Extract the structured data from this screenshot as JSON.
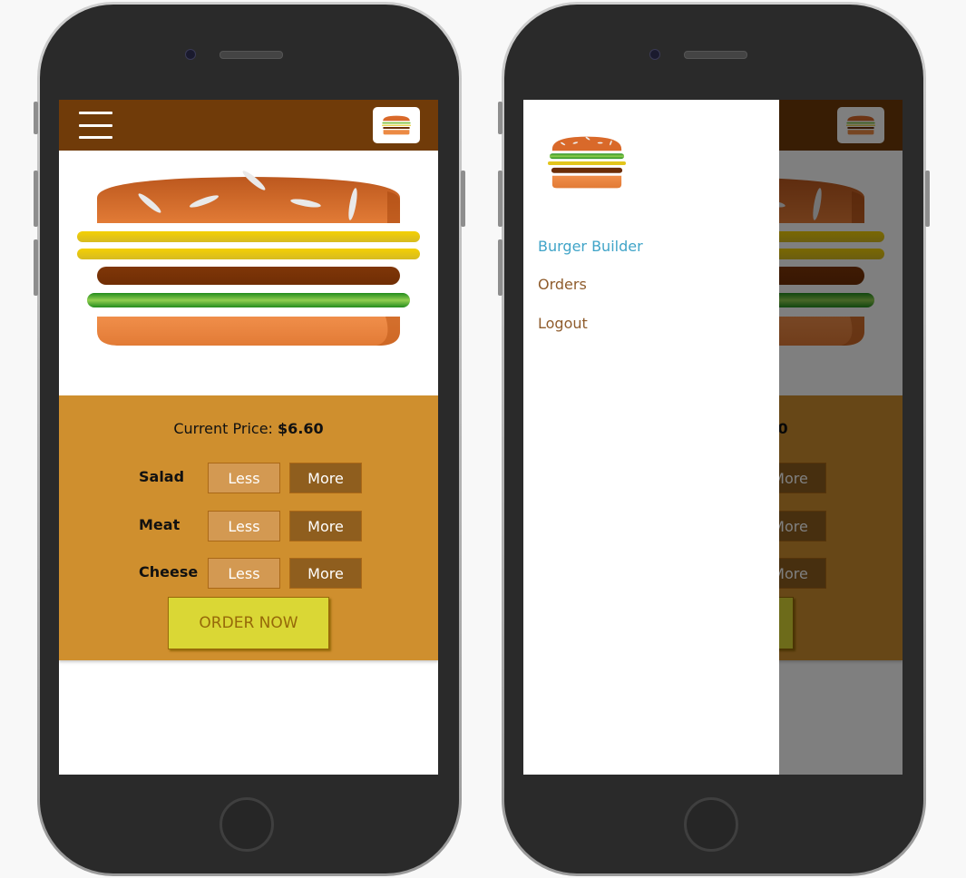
{
  "app": {
    "price_label": "Current Price:",
    "price_value": "$6.60",
    "controls": [
      {
        "label": "Salad",
        "less": "Less",
        "more": "More"
      },
      {
        "label": "Meat",
        "less": "Less",
        "more": "More"
      },
      {
        "label": "Cheese",
        "less": "Less",
        "more": "More"
      }
    ],
    "order_button": "ORDER NOW",
    "less_label": "Less",
    "more_label": "More"
  },
  "drawer": {
    "items": [
      {
        "label": "Burger Builder",
        "active": true
      },
      {
        "label": "Orders",
        "active": false
      },
      {
        "label": "Logout",
        "active": false
      }
    ]
  },
  "icons": {
    "menu": "hamburger-menu-icon",
    "logo": "burger-logo-icon"
  },
  "colors": {
    "toolbar": "#703b09",
    "controls_bg": "#cf8f2e",
    "less_bg": "#d39952",
    "more_bg": "#8f5e1e",
    "order_bg": "#dad735",
    "active_nav": "#40a4c8",
    "nav": "#8f5c2c"
  }
}
